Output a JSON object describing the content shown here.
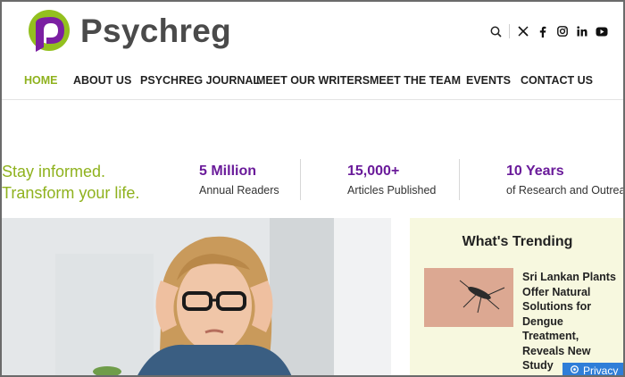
{
  "header": {
    "brand": "Psychreg",
    "social": [
      {
        "name": "search-icon",
        "glyph": "⌕"
      },
      {
        "name": "x-icon",
        "glyph": "𝕏"
      },
      {
        "name": "facebook-icon",
        "glyph": "f"
      },
      {
        "name": "instagram-icon",
        "glyph": "◎"
      },
      {
        "name": "linkedin-icon",
        "glyph": "in"
      },
      {
        "name": "youtube-icon",
        "glyph": "▶"
      }
    ]
  },
  "nav": {
    "items": [
      "HOME",
      "ABOUT US",
      "PSYCHREG JOURNAL",
      "MEET OUR WRITERS",
      "MEET THE TEAM",
      "EVENTS",
      "CONTACT US"
    ],
    "active_index": 0
  },
  "stats": {
    "tagline_line1": "Stay informed.",
    "tagline_line2": "Transform your life.",
    "items": [
      {
        "number": "5 Million",
        "label": "Annual Readers"
      },
      {
        "number": "15,000+",
        "label": "Articles Published"
      },
      {
        "number": "10 Years",
        "label": "of Research and Outreach"
      }
    ]
  },
  "trending": {
    "title": "What's Trending",
    "article_title": "Sri Lankan Plants Offer Natural Solutions for Dengue Treatment, Reveals New Study"
  },
  "privacy": {
    "label": "Privacy"
  },
  "colors": {
    "accent_green": "#8fb21e",
    "accent_purple": "#6a1b9a"
  }
}
